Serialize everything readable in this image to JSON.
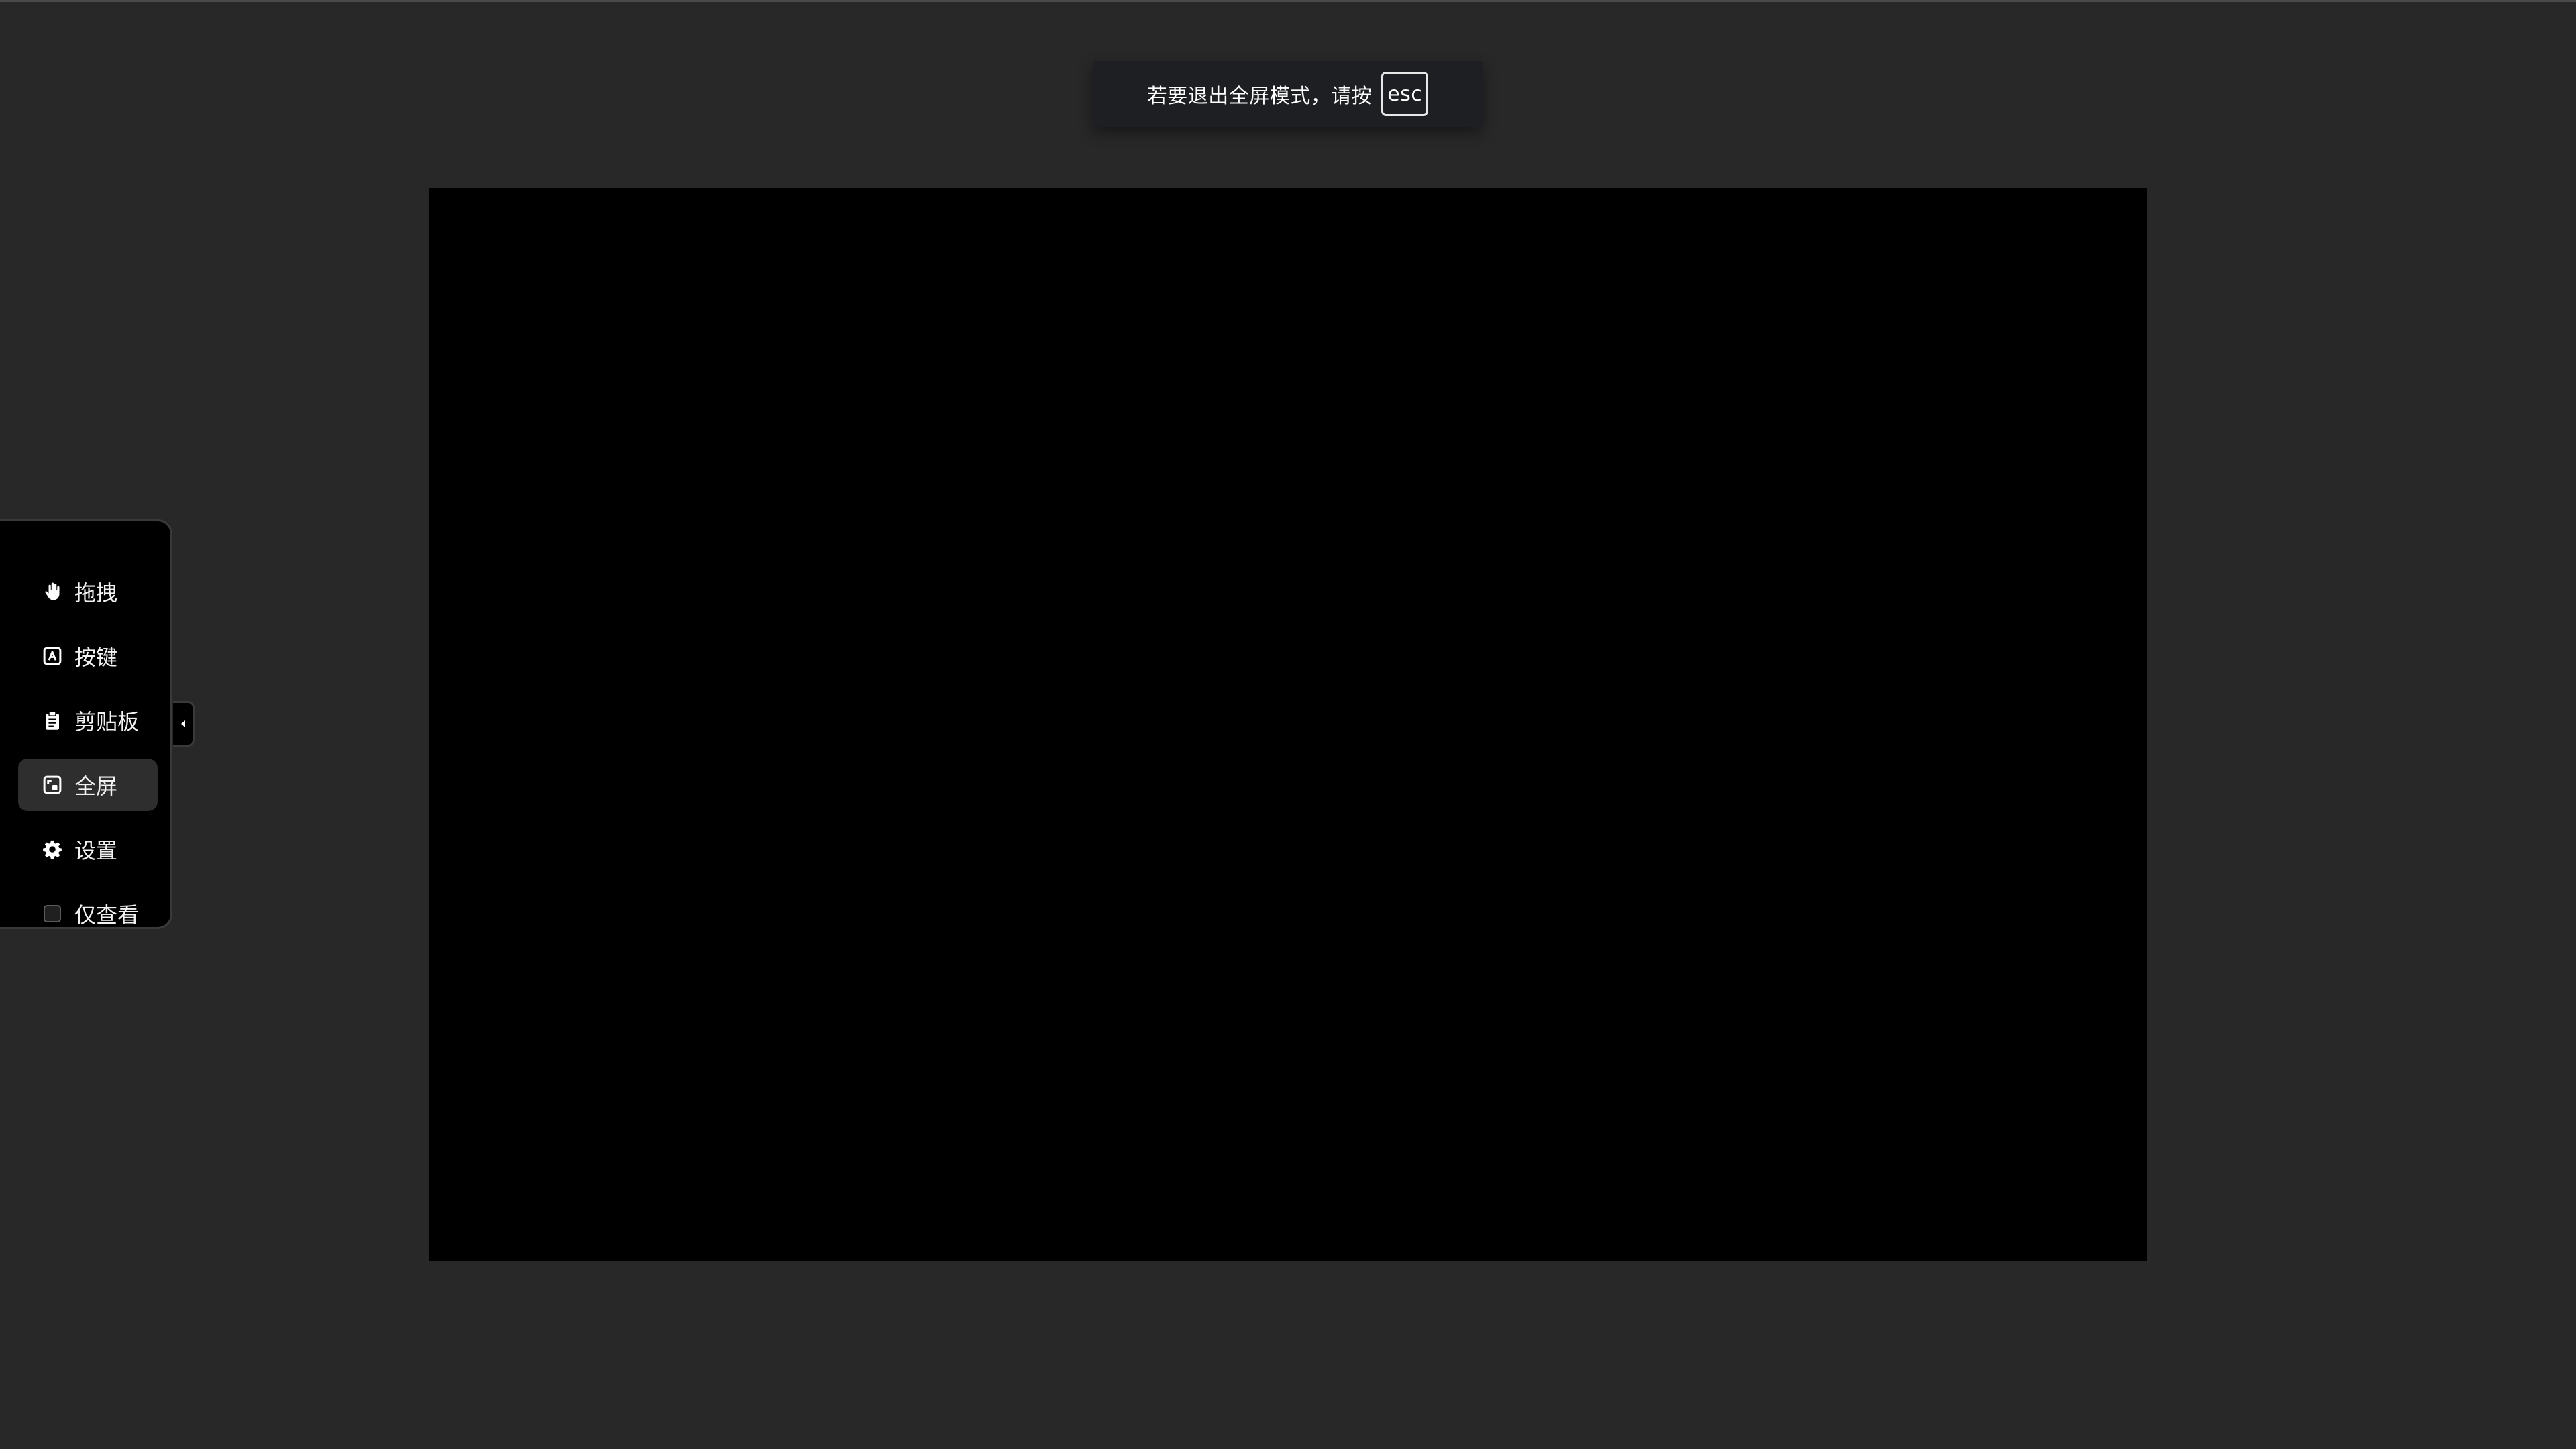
{
  "fullscreen_hint": {
    "message": "若要退出全屏模式，请按",
    "key": "esc"
  },
  "toolbar": {
    "items": [
      {
        "label": "拖拽",
        "icon": "hand-icon"
      },
      {
        "label": "按键",
        "icon": "keyboard-key-icon"
      },
      {
        "label": "剪贴板",
        "icon": "clipboard-icon"
      },
      {
        "label": "全屏",
        "icon": "fullscreen-icon",
        "active": true
      },
      {
        "label": "设置",
        "icon": "gear-icon"
      },
      {
        "label": "仅查看",
        "icon": "checkbox-icon",
        "checked": false
      }
    ],
    "collapse_icon": "chevron-left-icon"
  },
  "colors": {
    "background": "#282828",
    "screen": "#000000",
    "toolbar": "#000000",
    "active_item": "#2e2e2e",
    "text": "#f2f2f2"
  }
}
